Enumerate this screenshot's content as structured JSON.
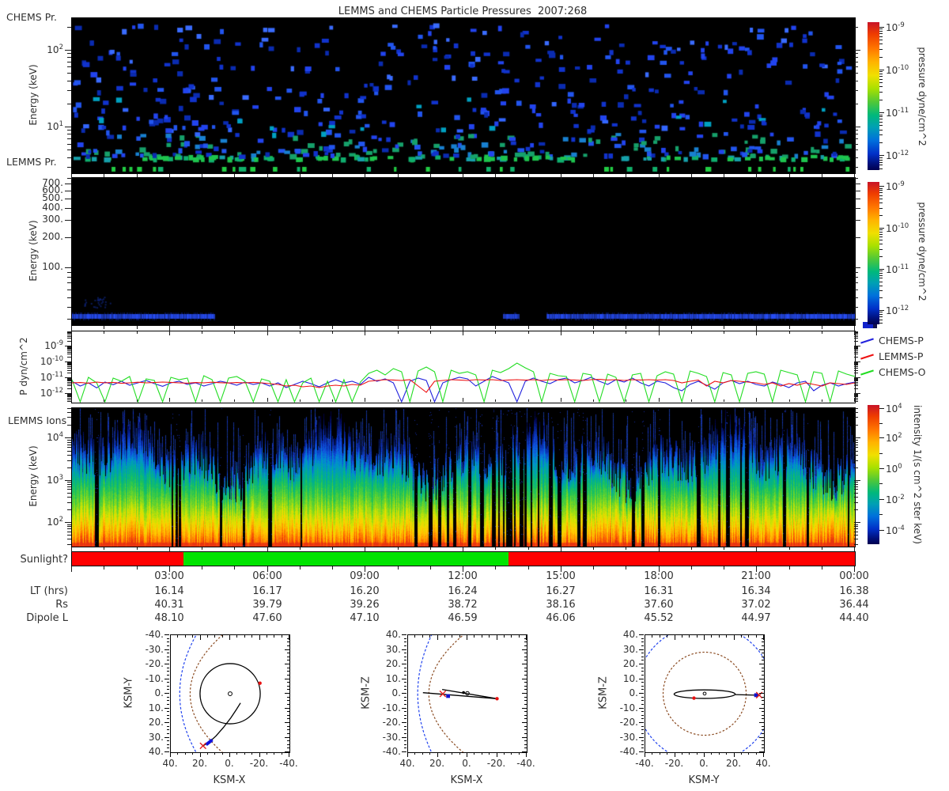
{
  "title": "LEMMS and CHEMS Particle Pressures  2007:268",
  "panel_labels": {
    "chems_pr": "CHEMS Pr.",
    "lemms_pr": "LEMMS Pr.",
    "lemms_ions": "LEMMS Ions",
    "sunlight": "Sunlight?",
    "energy": "Energy (keV)",
    "p_dyn": "P dyn/cm^2"
  },
  "legend": {
    "items": [
      {
        "label": "CHEMS-P",
        "color": "#2222dd"
      },
      {
        "label": "LEMMS-P",
        "color": "#ee1111"
      },
      {
        "label": "CHEMS-O",
        "color": "#22dd22"
      }
    ]
  },
  "colorbars": {
    "pressure1": {
      "label": "pressure dyne/cm^2",
      "majors": [
        {
          "frac": 0.03,
          "exp": "-9"
        },
        {
          "frac": 0.32,
          "exp": "-10"
        },
        {
          "frac": 0.61,
          "exp": "-11"
        },
        {
          "frac": 0.9,
          "exp": "-12"
        }
      ],
      "frac_per_decade": 0.29
    },
    "pressure2": {
      "label": "pressure dyne/cm^2",
      "majors": [
        {
          "frac": 0.03,
          "exp": "-9"
        },
        {
          "frac": 0.32,
          "exp": "-10"
        },
        {
          "frac": 0.61,
          "exp": "-11"
        },
        {
          "frac": 0.9,
          "exp": "-12"
        }
      ],
      "frac_per_decade": 0.29
    },
    "intensity": {
      "label": "intensity 1/(s cm^2 ster keV)",
      "majors": [
        {
          "frac": 0.02,
          "exp": "4"
        },
        {
          "frac": 0.235,
          "exp": "2"
        },
        {
          "frac": 0.455,
          "exp": "0"
        },
        {
          "frac": 0.675,
          "exp": "-2"
        },
        {
          "frac": 0.895,
          "exp": "-4"
        }
      ],
      "minor_fracs": [
        0.128,
        0.345,
        0.565,
        0.785
      ]
    }
  },
  "axes": {
    "p1y": {
      "majors": [
        {
          "frac": 0.209,
          "exp": "2"
        },
        {
          "frac": 0.704,
          "exp": "1"
        }
      ],
      "frac_per_decade": 0.495
    },
    "p2y": {
      "labels": [
        {
          "frac": 0.045,
          "text": "700."
        },
        {
          "frac": 0.09,
          "text": "600."
        },
        {
          "frac": 0.144,
          "text": "500."
        },
        {
          "frac": 0.209,
          "text": "400."
        },
        {
          "frac": 0.292,
          "text": "300."
        },
        {
          "frac": 0.411,
          "text": "200."
        },
        {
          "frac": 0.613,
          "text": "100."
        }
      ],
      "minor_fracs": [
        0.006,
        0.645,
        0.678,
        0.717,
        0.762,
        0.815,
        0.88,
        0.964
      ]
    },
    "p3y": {
      "majors": [
        {
          "frac": 0.211,
          "exp": "-9"
        },
        {
          "frac": 0.433,
          "exp": "-10"
        },
        {
          "frac": 0.656,
          "exp": "-11"
        },
        {
          "frac": 0.878,
          "exp": "-12"
        }
      ],
      "frac_per_decade": 0.222
    },
    "p4y": {
      "majors": [
        {
          "frac": 0.217,
          "exp": "4"
        },
        {
          "frac": 0.526,
          "exp": "3"
        },
        {
          "frac": 0.829,
          "exp": "2"
        }
      ],
      "frac_per_decade": 0.306
    }
  },
  "time_axis": {
    "row_labels": [
      "LT (hrs)",
      "Rs",
      "Dipole L"
    ],
    "columns": [
      {
        "frac": 0.125,
        "time": "03:00",
        "lt": "16.14",
        "rs": "40.31",
        "dipole": "48.10"
      },
      {
        "frac": 0.25,
        "time": "06:00",
        "lt": "16.17",
        "rs": "39.79",
        "dipole": "47.60"
      },
      {
        "frac": 0.375,
        "time": "09:00",
        "lt": "16.20",
        "rs": "39.26",
        "dipole": "47.10"
      },
      {
        "frac": 0.5,
        "time": "12:00",
        "lt": "16.24",
        "rs": "38.72",
        "dipole": "46.59"
      },
      {
        "frac": 0.625,
        "time": "15:00",
        "lt": "16.27",
        "rs": "38.16",
        "dipole": "46.06"
      },
      {
        "frac": 0.75,
        "time": "18:00",
        "lt": "16.31",
        "rs": "37.60",
        "dipole": "45.52"
      },
      {
        "frac": 0.875,
        "time": "21:00",
        "lt": "16.34",
        "rs": "37.02",
        "dipole": "44.97"
      },
      {
        "frac": 1.0,
        "time": "00:00",
        "lt": "16.38",
        "rs": "36.44",
        "dipole": "44.40"
      }
    ]
  },
  "chart_data": [
    {
      "id": "chems_pressure_spectrogram",
      "type": "heatmap",
      "panel_label": "CHEMS Pr.",
      "ylabel": "Energy (keV)",
      "y_scale": "log",
      "y_range_keV": [
        2.5,
        264
      ],
      "y_tick_labels": [
        "10^2",
        "10^1"
      ],
      "x_range": [
        "2007:268 00:00",
        "2007:269 00:00"
      ],
      "z_label": "pressure dyne/cm^2",
      "z_range": [
        "1e-12",
        "1e-9"
      ],
      "appearance": "sparse scattered pressure pixels on black; density and green/cyan colors increase toward low energy; green LEMMS pressure dashes along the bottom edge",
      "render_seed": 11,
      "n_points": 680
    },
    {
      "id": "lemms_pressure_spectrogram",
      "type": "heatmap",
      "panel_label": "LEMMS Pr.",
      "ylabel": "Energy (keV)",
      "y_scale": "log",
      "y_range_keV": [
        27,
        800
      ],
      "y_tick_labels": [
        "700.",
        "600.",
        "500.",
        "400.",
        "300.",
        "200.",
        "100."
      ],
      "z_label": "pressure dyne/cm^2",
      "z_range": [
        "1e-12",
        "1e-9"
      ],
      "appearance": "black panel with one bright blue band at ~33 keV, interrupted between ~04:20-13:10 except a short burst near 13:20",
      "band_segments_frac": [
        [
          0.0,
          0.182
        ],
        [
          0.551,
          0.571
        ],
        [
          0.606,
          1.0
        ]
      ],
      "band_y_frac": 0.935
    },
    {
      "id": "particle_pressure_lines",
      "type": "line",
      "ylabel": "P dyn/cm^2",
      "ylim_log10": [
        -12.55,
        -8.9
      ],
      "x_hours_range": [
        0,
        24
      ],
      "n_points": 96,
      "series": [
        {
          "name": "CHEMS-P",
          "color": "#2222dd",
          "log10_values": [
            -11.2,
            -11.5,
            -11.3,
            -11.62,
            -11.25,
            -11.42,
            -11.2,
            -11.45,
            -11.3,
            -11.15,
            -11.35,
            -11.52,
            -11.3,
            -11.2,
            -11.4,
            -11.3,
            -11.5,
            -11.35,
            -11.2,
            -11.3,
            -11.45,
            -11.25,
            -11.4,
            -11.3,
            -11.5,
            -11.3,
            -11.6,
            -11.4,
            -11.2,
            -11.35,
            -11.55,
            -11.3,
            -11.1,
            -11.3,
            -11.2,
            -11.4,
            -10.95,
            -11.2,
            -11.05,
            -11.3,
            -12.6,
            -11.2,
            -11.0,
            -11.15,
            -12.7,
            -11.3,
            -11.1,
            -10.95,
            -11.05,
            -11.5,
            -11.2,
            -10.9,
            -11.1,
            -11.3,
            -12.5,
            -11.2,
            -11.0,
            -11.2,
            -11.35,
            -11.1,
            -11.0,
            -11.3,
            -11.15,
            -10.95,
            -11.2,
            -11.4,
            -11.1,
            -11.25,
            -11.0,
            -11.3,
            -11.5,
            -11.2,
            -11.3,
            -11.6,
            -11.8,
            -11.4,
            -11.2,
            -11.45,
            -11.7,
            -11.3,
            -11.15,
            -11.35,
            -11.2,
            -11.4,
            -11.5,
            -11.25,
            -11.4,
            -11.6,
            -11.3,
            -11.2,
            -11.8,
            -11.45,
            -11.3,
            -11.5,
            -11.35,
            -11.25
          ]
        },
        {
          "name": "LEMMS-P",
          "color": "#ee1111",
          "log10_values": [
            -11.3,
            -11.28,
            -11.32,
            -11.25,
            -11.3,
            -11.27,
            -11.33,
            -11.3,
            -11.26,
            -11.3,
            -11.28,
            -11.25,
            -11.27,
            -11.3,
            -11.32,
            -11.28,
            -11.3,
            -11.26,
            -11.29,
            -11.31,
            -11.28,
            -11.3,
            -11.27,
            -11.3,
            -11.35,
            -11.4,
            -11.5,
            -11.45,
            -11.55,
            -11.5,
            -11.6,
            -11.5,
            -11.45,
            -11.5,
            -11.4,
            -11.45,
            -11.2,
            -11.15,
            -11.1,
            -11.12,
            -11.15,
            -11.1,
            -11.5,
            -11.9,
            -11.2,
            -11.15,
            -11.1,
            -11.12,
            -11.15,
            -11.1,
            -11.12,
            -11.1,
            -11.15,
            -11.12,
            -11.1,
            -11.13,
            -11.1,
            -11.15,
            -11.1,
            -11.12,
            -11.1,
            -11.12,
            -11.15,
            -11.1,
            -11.08,
            -11.12,
            -11.1,
            -11.15,
            -11.1,
            -11.12,
            -11.1,
            -11.13,
            -11.1,
            -11.15,
            -11.3,
            -11.2,
            -11.12,
            -11.5,
            -11.2,
            -11.3,
            -11.15,
            -11.2,
            -11.25,
            -11.3,
            -11.4,
            -11.3,
            -11.5,
            -11.35,
            -11.45,
            -11.3,
            -11.4,
            -11.5,
            -11.3,
            -11.35,
            -11.4,
            -11.3
          ]
        },
        {
          "name": "CHEMS-O",
          "color": "#22dd22",
          "log10_values": [
            -11.1,
            -13,
            -10.95,
            -11.3,
            -13,
            -11.0,
            -11.2,
            -10.9,
            -13,
            -11.05,
            -11.15,
            -13,
            -10.95,
            -11.1,
            -11.0,
            -13,
            -10.85,
            -11.1,
            -13,
            -11.0,
            -10.9,
            -11.2,
            -13,
            -11.05,
            -11.2,
            -13,
            -11.1,
            -13,
            -11.3,
            -11.0,
            -13,
            -11.2,
            -13,
            -11.1,
            -13,
            -11.25,
            -10.7,
            -10.5,
            -10.8,
            -10.4,
            -10.6,
            -13,
            -10.55,
            -10.3,
            -10.6,
            -13,
            -10.5,
            -10.7,
            -10.6,
            -10.8,
            -13,
            -10.5,
            -10.65,
            -10.4,
            -10.05,
            -10.35,
            -10.6,
            -13,
            -10.7,
            -10.85,
            -10.9,
            -13,
            -10.7,
            -10.8,
            -13,
            -10.75,
            -10.95,
            -13,
            -10.8,
            -10.7,
            -13,
            -10.85,
            -10.6,
            -10.75,
            -13,
            -10.55,
            -10.7,
            -10.9,
            -13,
            -10.65,
            -10.8,
            -13,
            -10.7,
            -10.6,
            -10.75,
            -13,
            -10.5,
            -10.65,
            -10.8,
            -13,
            -10.6,
            -10.7,
            -13,
            -10.55,
            -10.75,
            -10.9
          ]
        }
      ]
    },
    {
      "id": "lemms_ion_spectrogram",
      "type": "heatmap",
      "panel_label": "LEMMS Ions",
      "ylabel": "Energy (keV)",
      "y_scale": "log",
      "y_range_keV": [
        27,
        50000
      ],
      "y_tick_labels": [
        "10^4",
        "10^3",
        "10^2"
      ],
      "z_label": "intensity 1/(s cm^2 ster keV)",
      "z_range": [
        "1e-5",
        "1e4"
      ],
      "appearance": "dense vertically-striped spectrogram: hot orange/red at lowest energies grading through yellow, green, teal to blue at high energies; many narrow black dropout columns, more frequent between ~10:30 and 15:30",
      "render_seed": 29
    },
    {
      "id": "sunlight_bar",
      "type": "bar",
      "label": "Sunlight?",
      "segments": [
        {
          "from_frac": 0.0,
          "to_frac": 0.142,
          "from_hour": 0.0,
          "to_hour": 3.4,
          "color": "#ff0000",
          "state": "no"
        },
        {
          "from_frac": 0.142,
          "to_frac": 0.558,
          "from_hour": 3.4,
          "to_hour": 13.4,
          "color": "#00e400",
          "state": "yes"
        },
        {
          "from_frac": 0.558,
          "to_frac": 1.0,
          "from_hour": 13.4,
          "to_hour": 24.0,
          "color": "#ff0000",
          "state": "no"
        }
      ]
    },
    {
      "id": "orbit_xy",
      "type": "line",
      "xlabel": "KSM-X",
      "ylabel": "KSM-Y",
      "x_dir": -1,
      "y_dir": 1,
      "xtick_labels": [
        "40.",
        "20.",
        "0.",
        "-20.",
        "-40."
      ],
      "ytick_labels": [
        "-40.",
        "-30.",
        "-20.",
        "-10.",
        "0.",
        "10.",
        "20.",
        "30.",
        "40."
      ],
      "bow_shock": {
        "nose": 34,
        "k": 0.0069,
        "color": "#2244ee"
      },
      "magnetopause": {
        "nose": 27,
        "k": 0.0135,
        "color": "#8a4a20"
      },
      "circles": [
        {
          "cx": 0,
          "cy": 0,
          "r": 20.3,
          "style": "orbit"
        },
        {
          "cx": 0,
          "cy": 0,
          "r": 1.3,
          "style": "origin"
        }
      ],
      "trajectory": [
        [
          -7,
          6.3
        ],
        [
          -4.2,
          10.8
        ],
        [
          -0.5,
          16.5
        ],
        [
          4.5,
          23
        ],
        [
          9.5,
          28.8
        ],
        [
          13.8,
          32.8
        ],
        [
          18.3,
          35.6
        ]
      ],
      "highlight": [
        [
          12,
          31.5
        ],
        [
          16.2,
          34.8
        ]
      ],
      "red_x": [
        18.3,
        35.6
      ],
      "red_dot": [
        -20.1,
        -7.2
      ]
    },
    {
      "id": "orbit_xz",
      "type": "line",
      "xlabel": "KSM-X",
      "ylabel": "KSM-Z",
      "x_dir": -1,
      "y_dir": -1,
      "xtick_labels": [
        "40.",
        "20.",
        "0.",
        "-20.",
        "-40."
      ],
      "ytick_labels": [
        "40.",
        "30.",
        "20.",
        "10.",
        "0.",
        "-10.",
        "-20.",
        "-30.",
        "-40."
      ],
      "bow_shock": {
        "nose": 33.5,
        "k": 0.0058,
        "color": "#2244ee"
      },
      "magnetopause": {
        "nose": 26,
        "k": 0.0144,
        "color": "#8a4a20"
      },
      "circles": [
        {
          "cx": 0,
          "cy": 0.3,
          "r": 1.2,
          "style": "origin"
        },
        {
          "cx": 2.6,
          "cy": 0.8,
          "r": 0.7,
          "style": "dot"
        }
      ],
      "lines": [
        [
          [
            30,
            0.7
          ],
          [
            -20,
            -3.4
          ]
        ],
        [
          [
            17,
            2.9
          ],
          [
            -20,
            -3.4
          ]
        ]
      ],
      "blue_square": [
        13,
        -1.6
      ],
      "red_x": [
        16.6,
        -0.1
      ],
      "red_dot": [
        -20,
        -3.4
      ]
    },
    {
      "id": "orbit_yz",
      "type": "line",
      "xlabel": "KSM-Y",
      "ylabel": "KSM-Z",
      "x_dir": 1,
      "y_dir": -1,
      "xtick_labels": [
        "-40.",
        "-20.",
        "0.",
        "20.",
        "40."
      ],
      "ytick_labels": [
        "40.",
        "30.",
        "20.",
        "10.",
        "0.",
        "-10.",
        "-20.",
        "-30.",
        "-40."
      ],
      "bow_shock_circle": {
        "r": 46.5,
        "color": "#2244ee"
      },
      "magnetopause_circle": {
        "r": 28,
        "color": "#8a4a20"
      },
      "ellipse": {
        "cx": 0,
        "cy": -0.3,
        "rx": 20.6,
        "ry": 2.9
      },
      "lines": [
        [
          [
            20.6,
            -0.6
          ],
          [
            37.5,
            -1.1
          ]
        ]
      ],
      "circles": [
        {
          "cx": 0,
          "cy": 0.1,
          "r": 1.0,
          "style": "origin"
        }
      ],
      "blue_square": [
        34.7,
        -1
      ],
      "red_x": [
        36.8,
        -1
      ],
      "red_dot": [
        -7.2,
        -3
      ]
    }
  ]
}
